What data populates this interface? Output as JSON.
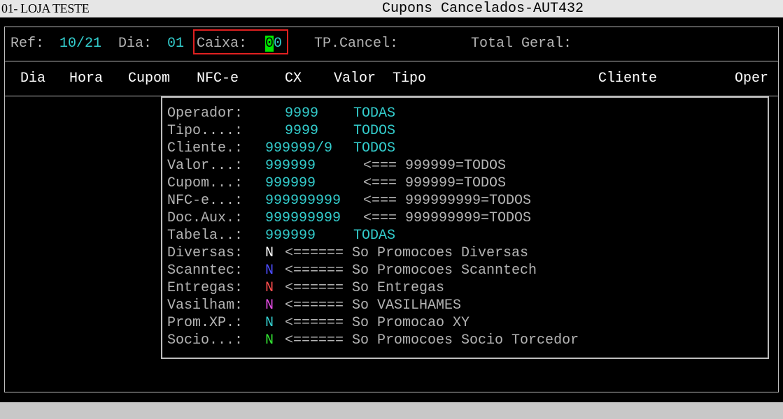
{
  "title_bar": {
    "store": "01- LOJA TESTE",
    "program_title": "Cupons Cancelados-AUT432"
  },
  "header_fields": {
    "ref_label": "Ref:",
    "ref_value": "10/21",
    "dia_label": "Dia:",
    "dia_value": "01",
    "caixa_label": "Caixa:",
    "caixa_value_cursor": "0",
    "caixa_value_rest": "0",
    "tp_cancel_label": "TP.Cancel:",
    "total_geral_label": "Total Geral:"
  },
  "columns": [
    "Dia",
    "Hora",
    "Cupom",
    "NFC-e",
    "CX",
    "Valor",
    "Tipo",
    "Cliente",
    "Oper"
  ],
  "filters": [
    {
      "label": "Operador:",
      "value": "9999",
      "note": "TODAS"
    },
    {
      "label": "Tipo....:",
      "value": "9999",
      "note": "TODOS"
    },
    {
      "label": "Cliente.:",
      "value": "999999/9",
      "note": "TODOS"
    },
    {
      "label": "Valor...:",
      "value": "999999",
      "note": "<=== 999999=TODOS"
    },
    {
      "label": "Cupom...:",
      "value": "999999",
      "note": "<=== 999999=TODOS"
    },
    {
      "label": "NFC-e...:",
      "value": "999999999",
      "note": "<=== 999999999=TODOS"
    },
    {
      "label": "Doc.Aux.:",
      "value": "999999999",
      "note": "<=== 999999999=TODOS"
    },
    {
      "label": "Tabela..:",
      "value": "999999",
      "note": "TODAS"
    },
    {
      "label": "Diversas:",
      "value": "N",
      "note": "<====== So Promocoes Diversas"
    },
    {
      "label": "Scanntec:",
      "value": "N",
      "note": "<====== So Promocoes Scanntech"
    },
    {
      "label": "Entregas:",
      "value": "N",
      "note": "<====== So Entregas"
    },
    {
      "label": "Vasilham:",
      "value": "N",
      "note": "<====== So VASILHAMES"
    },
    {
      "label": "Prom.XP.:",
      "value": "N",
      "note": "<====== So Promocao XY"
    },
    {
      "label": "Socio...:",
      "value": "N",
      "note": "<====== So Promocoes Socio Torcedor"
    }
  ],
  "colors": {
    "background": "#000000",
    "label": "#b4b4b4",
    "value_cyan": "#33cccc",
    "cursor_green": "#00e600",
    "highlight_red": "#e02020",
    "flag_white": "#ffffff",
    "flag_blue": "#4d4dff",
    "flag_red": "#ff4d4d",
    "flag_magenta": "#e64de6",
    "flag_cyan": "#33cccc",
    "flag_green": "#33e633"
  }
}
